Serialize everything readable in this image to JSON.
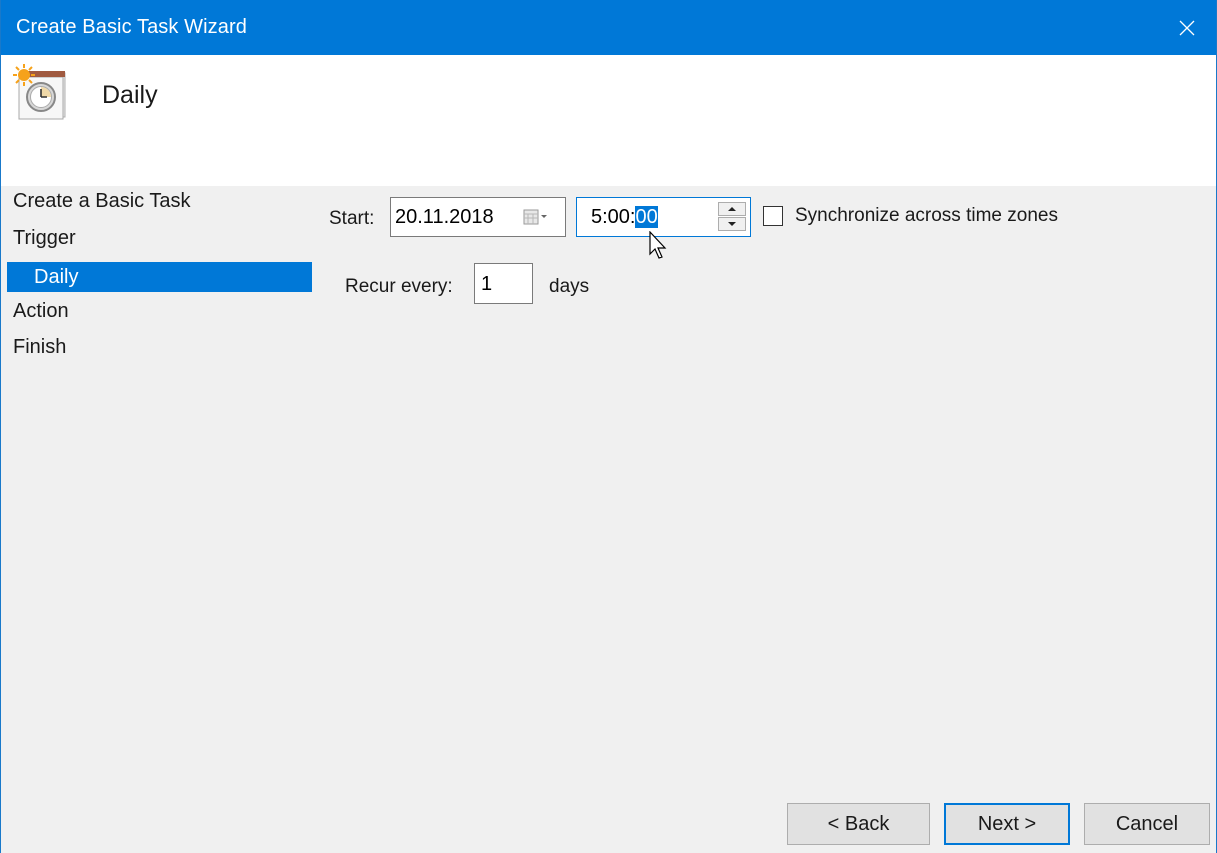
{
  "window": {
    "title": "Create Basic Task Wizard",
    "close_icon": "close-icon"
  },
  "header": {
    "icon": "task-scheduler-clock-sun-icon",
    "heading": "Daily"
  },
  "sidebar": {
    "items": [
      {
        "label": "Create a Basic Task",
        "selected": false,
        "sub": false
      },
      {
        "label": "Trigger",
        "selected": false,
        "sub": false
      },
      {
        "label": "Daily",
        "selected": true,
        "sub": true
      },
      {
        "label": "Action",
        "selected": false,
        "sub": false
      },
      {
        "label": "Finish",
        "selected": false,
        "sub": false
      }
    ]
  },
  "form": {
    "start_label": "Start:",
    "start_date": "20.11.2018",
    "date_picker_icon": "calendar-dropdown-icon",
    "start_time_prefix": "5:00:",
    "start_time_selected": "00",
    "spin_up_icon": "arrow-up-icon",
    "spin_down_icon": "arrow-down-icon",
    "sync_label": "Synchronize across time zones",
    "sync_checked": false,
    "recur_label": "Recur every:",
    "recur_value": "1",
    "recur_unit": "days"
  },
  "buttons": {
    "back": "< Back",
    "next": "Next >",
    "cancel": "Cancel"
  },
  "colors": {
    "accent": "#0078d7",
    "background": "#f0f0f0"
  }
}
